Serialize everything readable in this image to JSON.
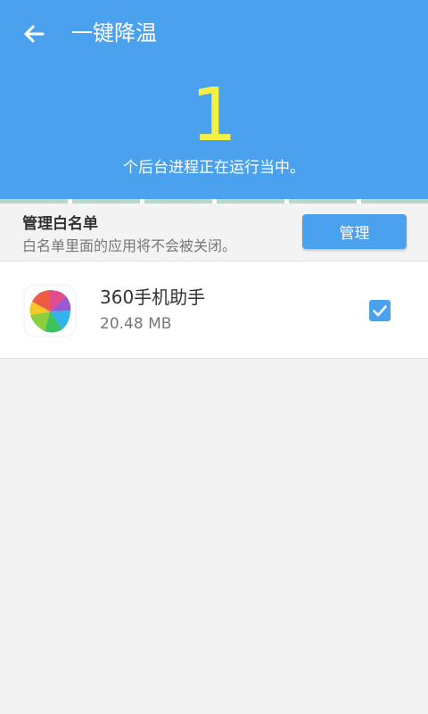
{
  "header": {
    "title": "一键降温",
    "process_count": "1",
    "process_caption": "个后台进程正在运行当中。"
  },
  "whitelist": {
    "title": "管理白名单",
    "description": "白名单里面的应用将不会被关闭。",
    "manage_label": "管理"
  },
  "processes": [
    {
      "name": "360手机助手",
      "size": "20.48 MB",
      "checked": true,
      "icon": "360-assistant-app-icon"
    }
  ],
  "colors": {
    "header_bg": "#4aa2ee",
    "count_text": "#f6ef44",
    "accent": "#4aa2ee",
    "background": "#f3f3f3"
  },
  "icons": [
    "back-arrow-icon",
    "360-assistant-app-icon",
    "checkbox-checked-icon"
  ]
}
